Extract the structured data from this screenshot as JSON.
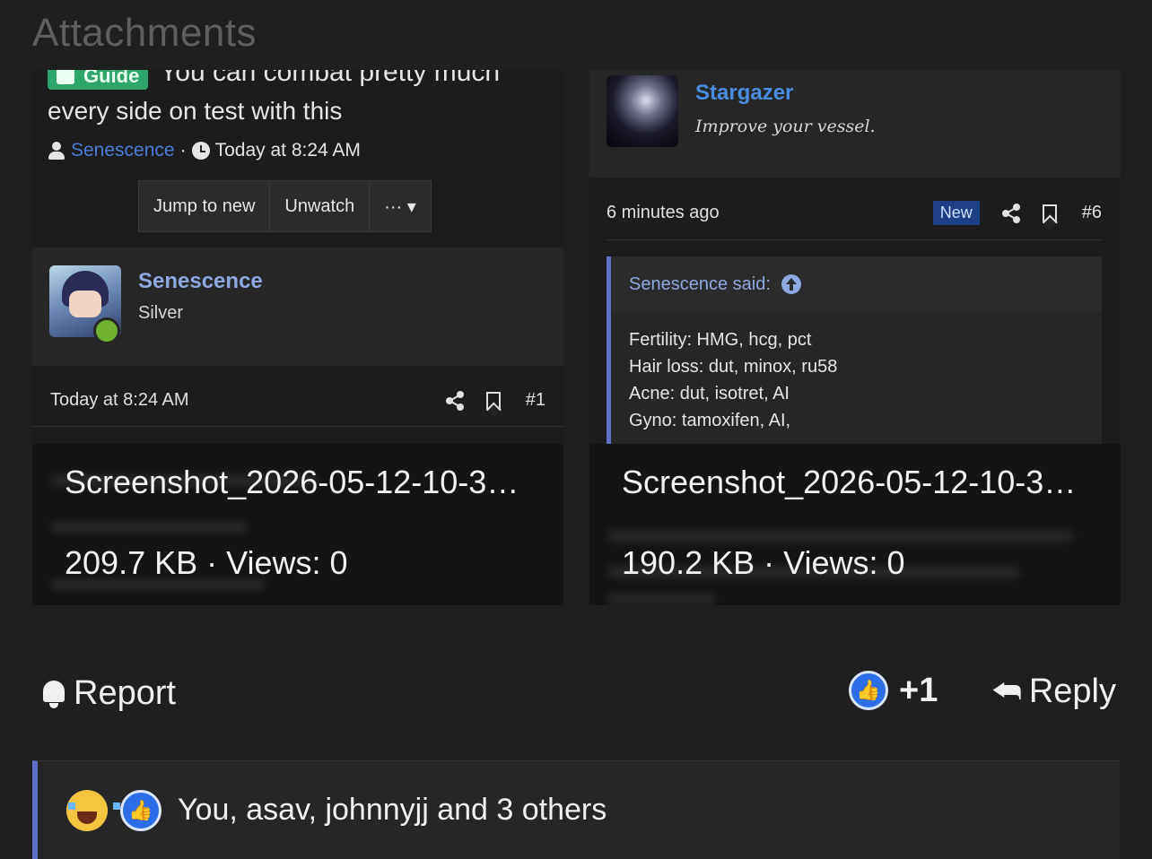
{
  "header": {
    "title": "Attachments"
  },
  "attachments": [
    {
      "filename": "Screenshot_2026-05-12-10-3…",
      "meta": "209.7 KB · Views: 0",
      "preview": {
        "tag": "Guide",
        "title_partial": "You can combat pretty much",
        "title_line2": "every side on test with this",
        "author": "Senescence",
        "separator": "·",
        "time": "Today at 8:24 AM",
        "buttons": [
          "Jump to new",
          "Unwatch",
          "··· ▾"
        ],
        "poster": {
          "name": "Senescence",
          "rank": "Silver"
        },
        "post_time": "Today at 8:24 AM",
        "post_number": "#1"
      }
    },
    {
      "filename": "Screenshot_2026-05-12-10-3…",
      "meta": "190.2 KB · Views: 0",
      "preview": {
        "poster": {
          "name": "Stargazer",
          "tagline": "Improve your vessel."
        },
        "post_time": "6 minutes ago",
        "badge": "New",
        "post_number": "#6",
        "quote_author": "Senescence said:",
        "quote_lines": [
          "Fertility: HMG, hcg, pct",
          "Hair loss: dut, minox, ru58",
          "Acne: dut, isotret, AI",
          "Gyno: tamoxifen, AI,"
        ]
      }
    }
  ],
  "actions": {
    "report": "Report",
    "like_count": "+1",
    "reply": "Reply"
  },
  "reactions": {
    "text": "You, asav, johnnyjj and 3 others"
  },
  "colors": {
    "background": "#1f1f1f",
    "link": "#4a8be0",
    "accent_bar": "#6170c9",
    "like_blue": "#2c6ee8",
    "guide_green": "#2ea66b"
  }
}
